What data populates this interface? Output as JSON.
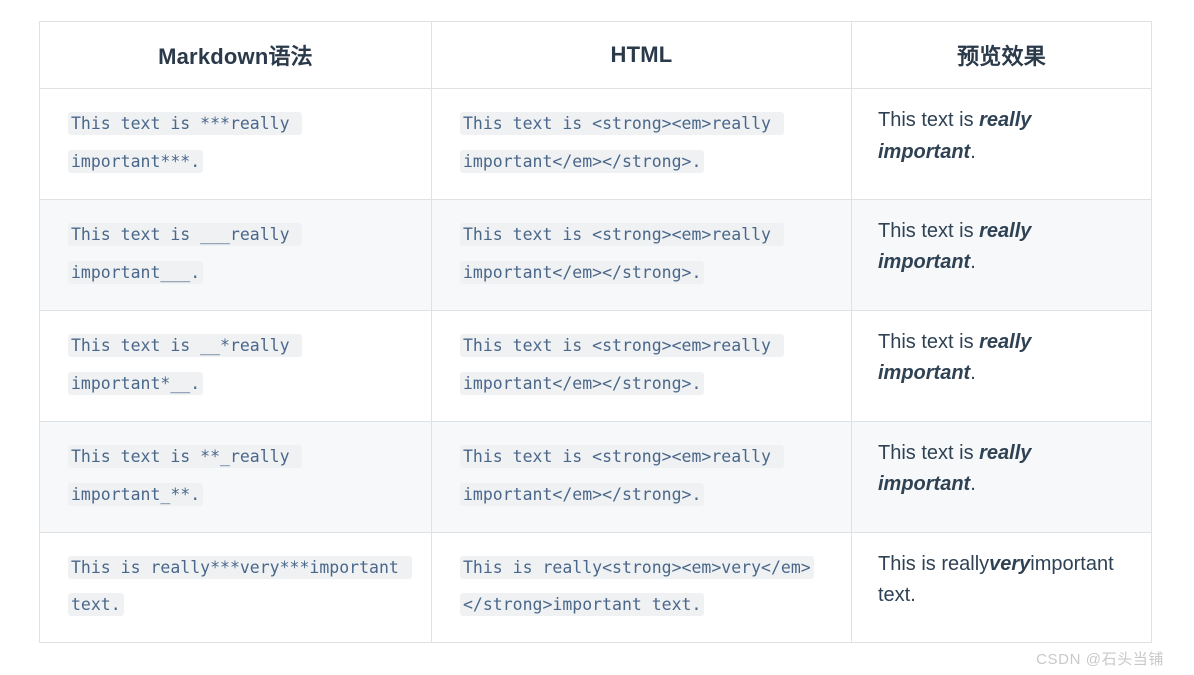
{
  "table": {
    "headers": [
      "Markdown语法",
      "HTML",
      "预览效果"
    ],
    "rows": [
      {
        "markdown": "This text is ***really important***.",
        "html": "This text is <strong><em>really important</em></strong>.",
        "preview": {
          "prefix": "This text is ",
          "emphasis": "really important",
          "suffix": "."
        }
      },
      {
        "markdown": "This text is ___really important___.",
        "html": "This text is <strong><em>really important</em></strong>.",
        "preview": {
          "prefix": "This text is ",
          "emphasis": "really important",
          "suffix": "."
        }
      },
      {
        "markdown": "This text is __*really important*__.",
        "html": "This text is <strong><em>really important</em></strong>.",
        "preview": {
          "prefix": "This text is ",
          "emphasis": "really important",
          "suffix": "."
        }
      },
      {
        "markdown": "This text is **_really important_**.",
        "html": "This text is <strong><em>really important</em></strong>.",
        "preview": {
          "prefix": "This text is ",
          "emphasis": "really important",
          "suffix": "."
        }
      },
      {
        "markdown": "This is really***very***important text.",
        "html": "This is really<strong><em>very</em></strong>important text.",
        "preview": {
          "prefix": "This is really",
          "emphasis": "very",
          "suffix": "important text."
        }
      }
    ]
  },
  "watermark": "CSDN @石头当铺",
  "colors": {
    "border": "#dfe2e5",
    "header_text": "#2b3a4a",
    "code_text": "#4a678a",
    "code_background": "#eff1f3",
    "row_alt_background": "#f6f8fa",
    "preview_text": "#2f4254",
    "watermark_text": "#c9c9c9"
  }
}
